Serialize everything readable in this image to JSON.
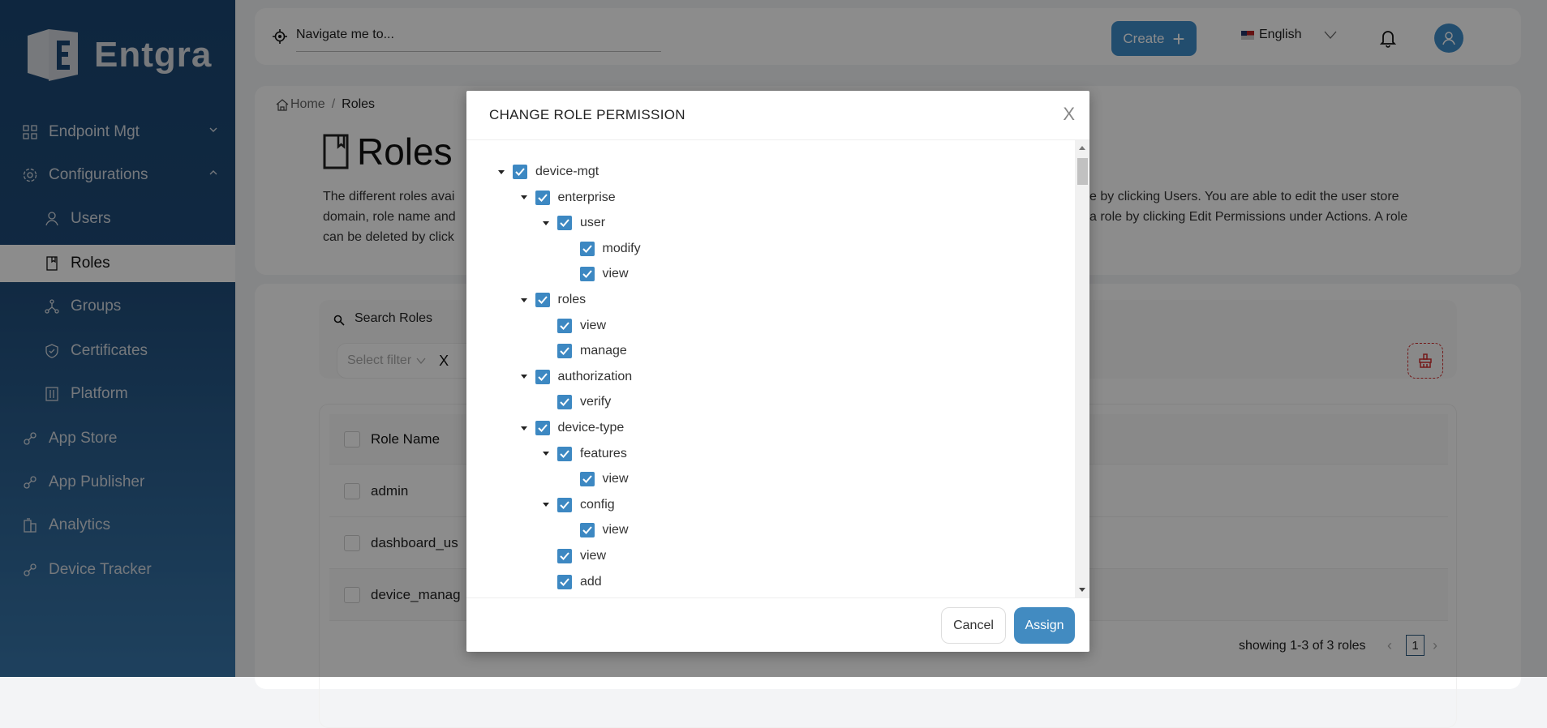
{
  "brand": {
    "name": "Entgra"
  },
  "sidebar": {
    "items": [
      {
        "label": "Endpoint Mgt",
        "icon": "grid-icon",
        "level": "top",
        "chevron": "down"
      },
      {
        "label": "Configurations",
        "icon": "gear-icon",
        "level": "top",
        "chevron": "up"
      },
      {
        "label": "Users",
        "icon": "user-icon",
        "level": "sub"
      },
      {
        "label": "Roles",
        "icon": "book-icon",
        "level": "sub",
        "active": true
      },
      {
        "label": "Groups",
        "icon": "groups-icon",
        "level": "sub"
      },
      {
        "label": "Certificates",
        "icon": "shield-icon",
        "level": "sub"
      },
      {
        "label": "Platform",
        "icon": "sliders-icon",
        "level": "sub"
      },
      {
        "label": "App Store",
        "icon": "link-icon",
        "level": "top"
      },
      {
        "label": "App Publisher",
        "icon": "link-icon",
        "level": "top"
      },
      {
        "label": "Analytics",
        "icon": "building-icon",
        "level": "top"
      },
      {
        "label": "Device Tracker",
        "icon": "link-icon",
        "level": "top"
      }
    ]
  },
  "header": {
    "nav_placeholder": "Navigate me to...",
    "create_label": "Create",
    "language": "English"
  },
  "breadcrumb": {
    "home": "Home",
    "separator": "/",
    "current": "Roles"
  },
  "page": {
    "title": "Roles",
    "description_visible": [
      {
        "left": "The different roles avai",
        "right": "e by clicking Users. You are able to edit the user store"
      },
      {
        "left": "domain, role name and",
        "right": "a role by clicking Edit Permissions under Actions. A role"
      },
      {
        "left": "can be deleted by click",
        "right": ""
      }
    ]
  },
  "search": {
    "label": "Search Roles",
    "filter_placeholder": "Select filter",
    "clear_label": "X"
  },
  "table": {
    "header": "Role Name",
    "rows": [
      "admin",
      "dashboard_us",
      "device_manag"
    ]
  },
  "pagination": {
    "summary": "showing 1-3 of 3 roles",
    "current_page": "1"
  },
  "modal": {
    "title": "CHANGE ROLE PERMISSION",
    "close": "X",
    "cancel": "Cancel",
    "assign": "Assign",
    "tree": [
      {
        "label": "device-mgt",
        "depth": 0,
        "expanded": true,
        "checked": true
      },
      {
        "label": "enterprise",
        "depth": 1,
        "expanded": true,
        "checked": true
      },
      {
        "label": "user",
        "depth": 2,
        "expanded": true,
        "checked": true
      },
      {
        "label": "modify",
        "depth": 3,
        "checked": true
      },
      {
        "label": "view",
        "depth": 3,
        "checked": true
      },
      {
        "label": "roles",
        "depth": 1,
        "expanded": true,
        "checked": true
      },
      {
        "label": "view",
        "depth": 2,
        "checked": true
      },
      {
        "label": "manage",
        "depth": 2,
        "checked": true
      },
      {
        "label": "authorization",
        "depth": 1,
        "expanded": true,
        "checked": true
      },
      {
        "label": "verify",
        "depth": 2,
        "checked": true
      },
      {
        "label": "device-type",
        "depth": 1,
        "expanded": true,
        "checked": true
      },
      {
        "label": "features",
        "depth": 2,
        "expanded": true,
        "checked": true
      },
      {
        "label": "view",
        "depth": 3,
        "checked": true
      },
      {
        "label": "config",
        "depth": 2,
        "expanded": true,
        "checked": true
      },
      {
        "label": "view",
        "depth": 3,
        "checked": true
      },
      {
        "label": "view",
        "depth": 2,
        "checked": true
      },
      {
        "label": "add",
        "depth": 2,
        "checked": true
      }
    ]
  },
  "colors": {
    "primary": "#3d88c2",
    "sidebar": "#1b4673",
    "danger": "#d32f2f"
  }
}
